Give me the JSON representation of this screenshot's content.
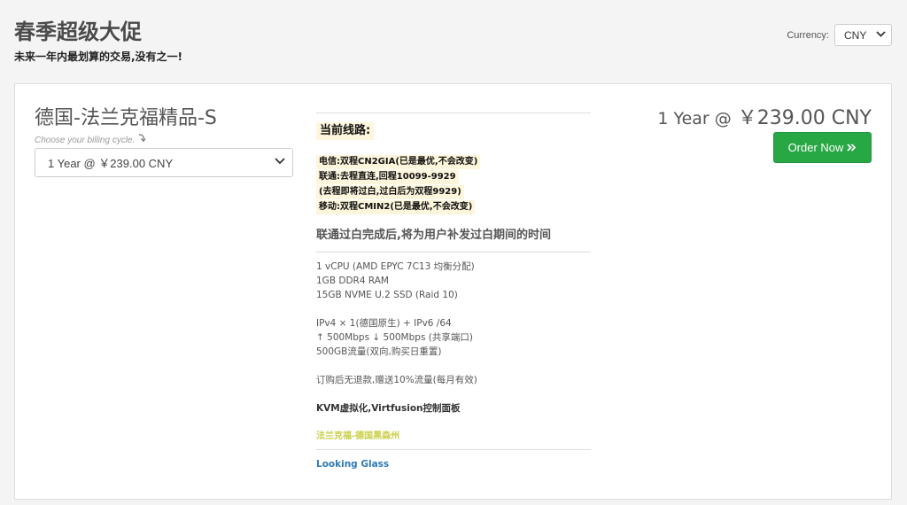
{
  "header": {
    "title": "春季超级大促",
    "subtitle": "未来一年内最划算的交易,没有之一!"
  },
  "currency": {
    "label": "Currency:",
    "selected": "CNY"
  },
  "product": {
    "name": "德国-法兰克福精品-S",
    "billing_hint": "Choose your billing cycle.",
    "billing_selected": "1 Year @ ￥239.00 CNY",
    "price_prefix": "1 Year @",
    "price_amount": "￥239.00 CNY",
    "order_label": "Order Now",
    "route_heading": "当前线路:",
    "route_lines": [
      "电信:双程CN2GIA(已是最优,不会改变)",
      "联通:去程直连,回程10099-9929",
      "(去程即将过白,过白后为双程9929)",
      "移动:双程CMIN2(已是最优,不会改变)"
    ],
    "notice": "联通过白完成后,将为用户补发过白期间的时间",
    "specs_group1": [
      "1 vCPU (AMD EPYC 7C13 均衡分配)",
      "1GB DDR4 RAM",
      "15GB NVME U.2 SSD (Raid 10)"
    ],
    "specs_group2": [
      "IPv4 × 1(德国原生) + IPv6 /64",
      "↑ 500Mbps ↓ 500Mbps (共享端口)",
      "500GB流量(双向,购买日重置)"
    ],
    "refund_note": "订购后无退款,赠送10%流量(每月有效)",
    "virt_note": "KVM虚拟化,Virtfusion控制面板",
    "location": "法兰克福-德国黑森州",
    "looking_glass": "Looking Glass"
  },
  "icons": {
    "currency_chevron": "chevron-down-icon",
    "billing_chevron": "chevron-down-icon",
    "hint_arrow": "curved-arrow-down-icon",
    "order_arrow": "double-chevron-right-icon"
  },
  "colors": {
    "order_button": "#28a745",
    "location_text": "#c9cf47",
    "link": "#2e7ab6",
    "route_highlight": "#fdf6dc"
  }
}
